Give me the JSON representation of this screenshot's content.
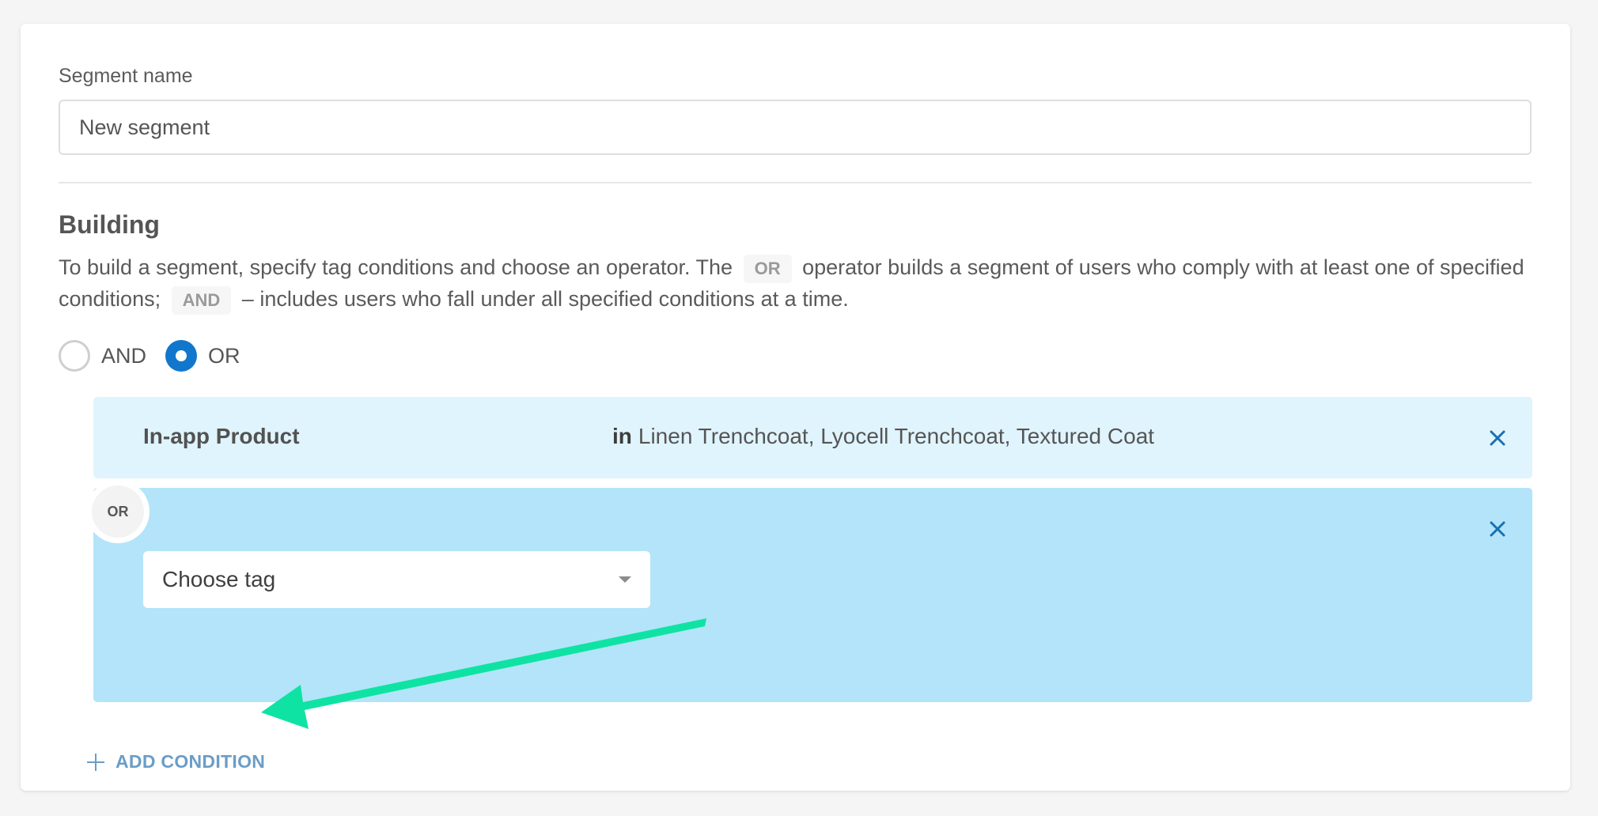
{
  "segment": {
    "name_label": "Segment name",
    "name_value": "New segment"
  },
  "building": {
    "title": "Building",
    "description_part1": "To build a segment, specify tag conditions and choose an operator. The",
    "description_op_or": "OR",
    "description_part2": "operator builds a segment of users who comply with at least one of specified conditions;",
    "description_op_and": "AND",
    "description_part3": "– includes users who fall under all specified conditions at a time.",
    "operators": [
      {
        "label": "AND",
        "selected": false
      },
      {
        "label": "OR",
        "selected": true
      }
    ],
    "or_badge": "OR"
  },
  "conditions": [
    {
      "tag": "In-app Product",
      "operator": "in",
      "value": "Linen Trenchcoat, Lyocell Trenchcoat, Textured Coat"
    }
  ],
  "new_condition": {
    "tag_placeholder": "Choose tag"
  },
  "actions": {
    "add_condition": "ADD CONDITION"
  },
  "colors": {
    "accent": "#1177cc",
    "condition_bg": "#e0f4fd",
    "editing_bg": "#b3e4f9",
    "add_link": "#6b9dc7",
    "annotation_arrow": "#0fe3a3"
  },
  "icons": {
    "close": "close-icon",
    "plus": "plus-icon",
    "dropdown": "chevron-down-icon"
  }
}
